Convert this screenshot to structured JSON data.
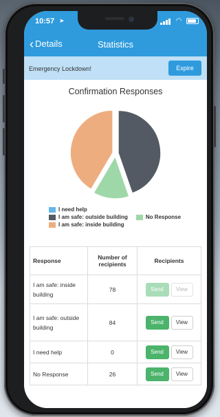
{
  "status": {
    "time": "10:57",
    "location_icon": "location-arrow-icon"
  },
  "nav": {
    "back_label": "Details",
    "title": "Statistics"
  },
  "alert": {
    "text": "Emergency Lockdown!",
    "expire_label": "Expire"
  },
  "colors": {
    "accent": "#2f9bdd",
    "alert_bg": "#bfe0f6",
    "send_green": "#4cb36b",
    "slice_help": "#63b6e6",
    "slice_outside": "#545a63",
    "slice_noresponse": "#9fd8a8",
    "slice_inside": "#eead7f"
  },
  "chart_data": {
    "type": "pie",
    "title": "Confirmation Responses",
    "slices": [
      {
        "label": "I need help",
        "value": 0,
        "color": "#63b6e6"
      },
      {
        "label": "I am safe: outside building",
        "value": 84,
        "color": "#545a63"
      },
      {
        "label": "No Response",
        "value": 26,
        "color": "#9fd8a8"
      },
      {
        "label": "I am safe: inside building",
        "value": 78,
        "color": "#eead7f"
      }
    ],
    "legend": [
      [
        "I need help"
      ],
      [
        "I am safe: outside building",
        "No Response"
      ],
      [
        "I am safe: inside building"
      ]
    ]
  },
  "table": {
    "headers": [
      "Response",
      "Number of recipients",
      "Recipients"
    ],
    "rows": [
      {
        "response": "I am safe: inside building",
        "count": "78",
        "send_enabled": false
      },
      {
        "response": "I am safe: outside building",
        "count": "84",
        "send_enabled": true
      },
      {
        "response": "I need help",
        "count": "0",
        "send_enabled": true
      },
      {
        "response": "No Response",
        "count": "26",
        "send_enabled": true
      }
    ],
    "send_label": "Send",
    "view_label": "View"
  }
}
